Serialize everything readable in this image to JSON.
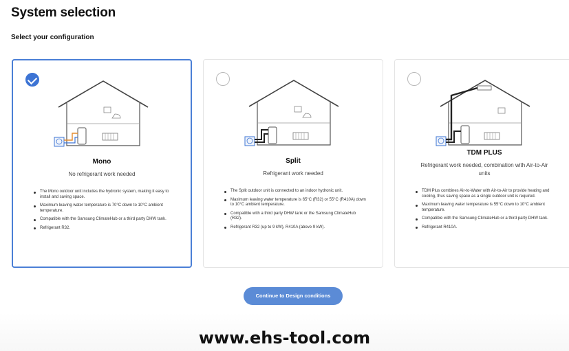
{
  "page": {
    "title": "System selection",
    "subtitle": "Select your configuration"
  },
  "cards": [
    {
      "name": "Mono",
      "selected": true,
      "description": "No refrigerant work needed",
      "bullets": [
        "The Mono outdoor unit includes the hydronic system, making it easy to install and saving space.",
        "Maximum leaving water temperature is 70°C down to 10°C ambient temperature.",
        "Compatible with the Samsung ClimateHub or a third party DHW tank.",
        "Refrigerant R32."
      ]
    },
    {
      "name": "Split",
      "selected": false,
      "description": "Refrigerant work needed",
      "bullets": [
        "The Split outdoor unit is connected to an indoor hydronic unit.",
        "Maximum leaving water temperature is 65°C (R32) or 55°C (R410A) down to 10°C ambient temperature.",
        "Compatible with a third party DHW tank or the Samsung ClimateHub (R32).",
        "Refrigerant R32 (up to 9 kW), R410A (above 9 kW)."
      ]
    },
    {
      "name": "TDM PLUS",
      "selected": false,
      "description": "Refrigerant work needed, combination with Air-to-Air units",
      "bullets": [
        "TDM Plus combines Air-to-Water with Air-to-Air to provide heating and cooling, thus saving space as a single outdoor unit is required.",
        "Maximum leaving water temperature is 55°C down to 10°C ambient temperature.",
        "Compatible with the Samsung ClimateHub or a third party DHW tank.",
        "Refrigerant R410A."
      ]
    }
  ],
  "cta": {
    "label": "Continue to Design conditions"
  },
  "watermark": "www.ehs-tool.com",
  "colors": {
    "accent": "#3d74d4",
    "button": "#5b8bd6",
    "pipe_water": "#e48a2c",
    "pipe_refrigerant": "#222222"
  },
  "icons": {
    "selected_radio": "check-circle-icon",
    "unselected_radio": "empty-circle-icon",
    "illustration": "house-icon"
  }
}
